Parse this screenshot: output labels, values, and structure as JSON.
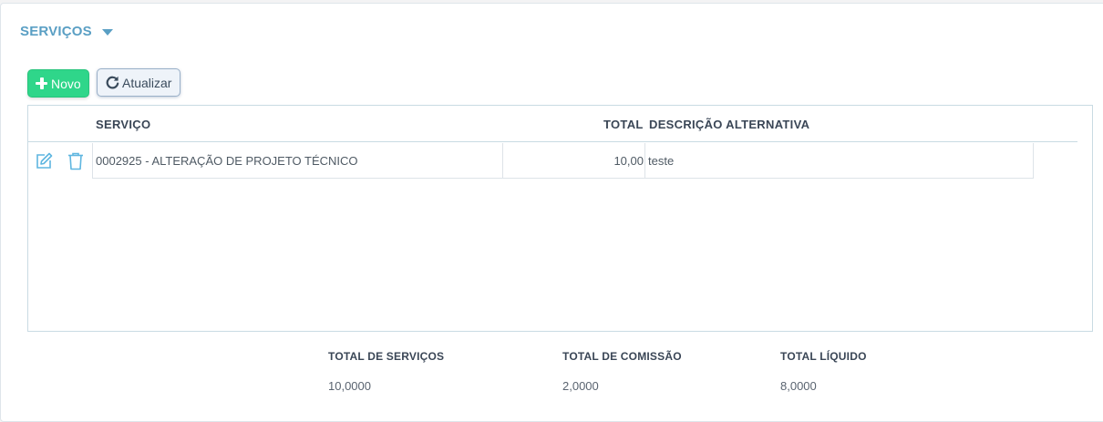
{
  "section": {
    "title": "SERVIÇOS"
  },
  "toolbar": {
    "new_label": "Novo",
    "refresh_label": "Atualizar"
  },
  "grid": {
    "columns": [
      "SERVIÇO",
      "TOTAL",
      "DESCRIÇÃO ALTERNATIVA"
    ],
    "rows": [
      {
        "servico": "0002925 - ALTERAÇÃO DE PROJETO TÉCNICO",
        "total": "10,00",
        "descricao": "teste"
      }
    ]
  },
  "totals": {
    "servicos": {
      "label": "TOTAL DE SERVIÇOS",
      "value": "10,0000"
    },
    "comissao": {
      "label": "TOTAL DE COMISSÃO",
      "value": "2,0000"
    },
    "liquido": {
      "label": "TOTAL LÍQUIDO",
      "value": "8,0000"
    }
  },
  "colors": {
    "accent": "#5a9fc4",
    "new_button": "#2fd68a",
    "icon": "#5fb6e0"
  },
  "icons": [
    "edit-icon",
    "trash-icon",
    "plus-icon",
    "refresh-icon",
    "caret-down-icon"
  ]
}
